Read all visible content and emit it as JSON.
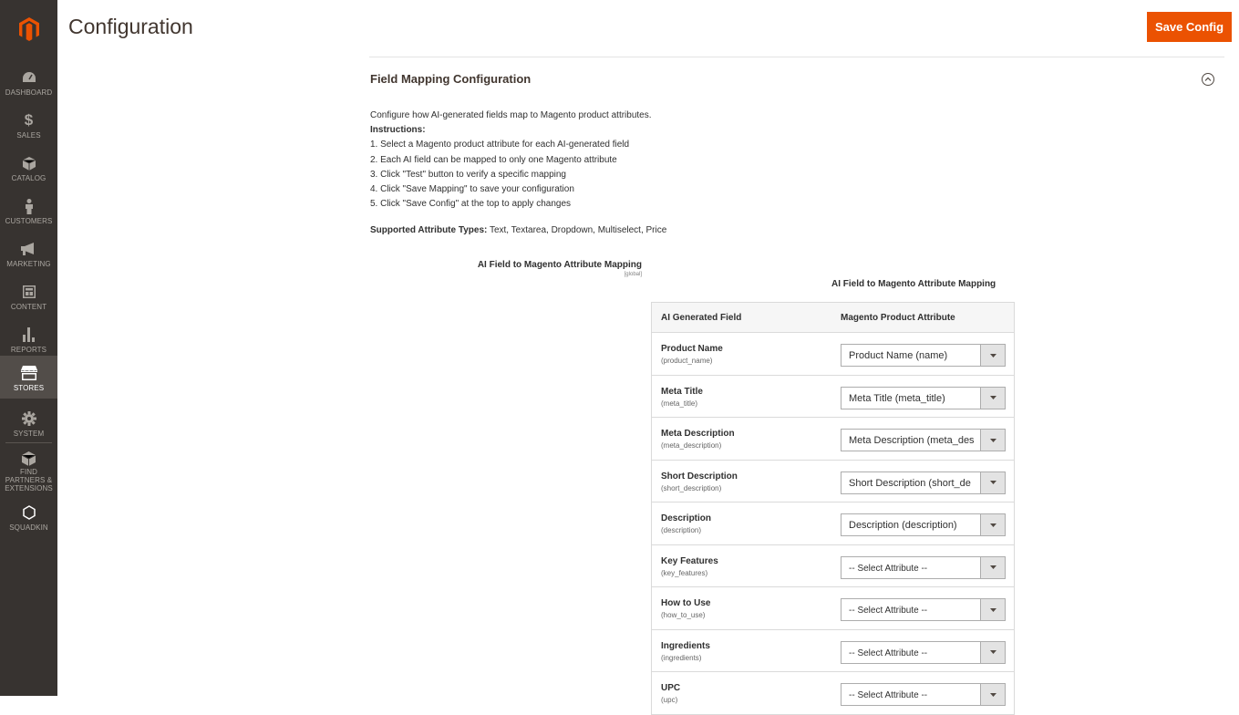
{
  "sidebar": {
    "items": [
      {
        "label": "DASHBOARD",
        "icon": "dashboard-icon"
      },
      {
        "label": "SALES",
        "icon": "dollar-icon"
      },
      {
        "label": "CATALOG",
        "icon": "box-icon"
      },
      {
        "label": "CUSTOMERS",
        "icon": "person-icon"
      },
      {
        "label": "MARKETING",
        "icon": "megaphone-icon"
      },
      {
        "label": "CONTENT",
        "icon": "layout-icon"
      },
      {
        "label": "REPORTS",
        "icon": "bar-chart-icon"
      },
      {
        "label": "STORES",
        "icon": "store-icon"
      },
      {
        "label": "SYSTEM",
        "icon": "gear-icon"
      },
      {
        "label": "FIND PARTNERS & EXTENSIONS",
        "icon": "cube-icon"
      },
      {
        "label": "SQUADKIN",
        "icon": "hexagon-icon"
      }
    ],
    "active": "STORES"
  },
  "header": {
    "title": "Configuration",
    "save_label": "Save Config"
  },
  "section": {
    "title": "Field Mapping Configuration",
    "intro": "Configure how AI-generated fields map to Magento product attributes.",
    "instructions_label": "Instructions:",
    "instructions": [
      "1. Select a Magento product attribute for each AI-generated field",
      "2. Each AI field can be mapped to only one Magento attribute",
      "3. Click \"Test\" button to verify a specific mapping",
      "4. Click \"Save Mapping\" to save your configuration",
      "5. Click \"Save Config\" at the top to apply changes"
    ],
    "supported_label": "Supported Attribute Types:",
    "supported_types": "Text, Textarea, Dropdown, Multiselect, Price",
    "field_label": "AI Field to Magento Attribute Mapping",
    "scope": "[global]",
    "table_title": "AI Field to Magento Attribute Mapping"
  },
  "table": {
    "headers": [
      "AI Generated Field",
      "Magento Product Attribute"
    ],
    "rows": [
      {
        "name": "Product Name",
        "code": "(product_name)",
        "value": "Product Name (name)"
      },
      {
        "name": "Meta Title",
        "code": "(meta_title)",
        "value": "Meta Title (meta_title)"
      },
      {
        "name": "Meta Description",
        "code": "(meta_description)",
        "value": "Meta Description (meta_des"
      },
      {
        "name": "Short Description",
        "code": "(short_description)",
        "value": "Short Description (short_de"
      },
      {
        "name": "Description",
        "code": "(description)",
        "value": "Description (description)"
      },
      {
        "name": "Key Features",
        "code": "(key_features)",
        "value": "-- Select Attribute --"
      },
      {
        "name": "How to Use",
        "code": "(how_to_use)",
        "value": "-- Select Attribute --"
      },
      {
        "name": "Ingredients",
        "code": "(ingredients)",
        "value": "-- Select Attribute --"
      },
      {
        "name": "UPC",
        "code": "(upc)",
        "value": "-- Select Attribute --"
      }
    ]
  },
  "colors": {
    "sidebar_bg": "#373330",
    "sidebar_active": "#524d49",
    "accent": "#eb5202",
    "logo": "#eb5202"
  }
}
